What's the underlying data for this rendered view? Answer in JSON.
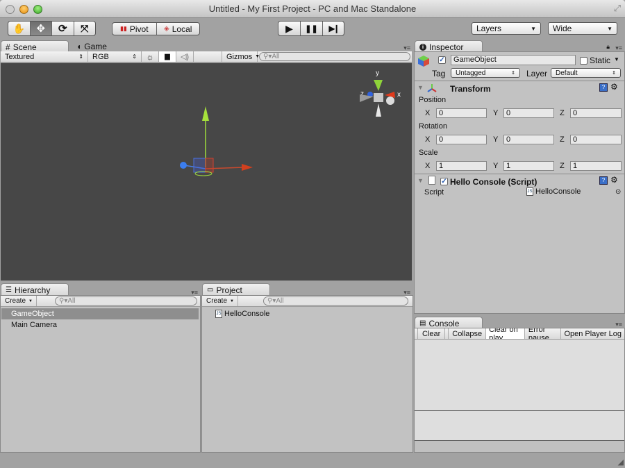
{
  "window": {
    "title": "Untitled - My First Project - PC and Mac Standalone",
    "traffic_lights": {
      "close": "#c8c8c8",
      "minimize": "#f0a020",
      "zoom": "#50c040"
    }
  },
  "toolbar": {
    "tools": [
      {
        "name": "hand-tool",
        "icon": "✋",
        "active": false
      },
      {
        "name": "move-tool",
        "icon": "✥",
        "active": true
      },
      {
        "name": "rotate-tool",
        "icon": "⟳",
        "active": false
      },
      {
        "name": "scale-tool",
        "icon": "⤧",
        "active": false
      }
    ],
    "pivot_label": "Pivot",
    "local_label": "Local",
    "play_icon": "▶",
    "pause_icon": "❚❚",
    "step_icon": "▶❙",
    "layers_label": "Layers",
    "layout_label": "Wide"
  },
  "scene": {
    "tabs": [
      {
        "label": "Scene",
        "icon": "#"
      },
      {
        "label": "Game",
        "icon": "◖"
      }
    ],
    "render_mode": "Textured",
    "color_mode": "RGB",
    "gizmos_label": "Gizmos",
    "search_placeholder": "All",
    "axis_labels": {
      "x": "x",
      "y": "y",
      "z": "z"
    }
  },
  "hierarchy": {
    "tab_label": "Hierarchy",
    "create_label": "Create",
    "search_placeholder": "All",
    "items": [
      {
        "label": "GameObject",
        "selected": true
      },
      {
        "label": "Main Camera",
        "selected": false
      }
    ]
  },
  "project": {
    "tab_label": "Project",
    "create_label": "Create",
    "search_placeholder": "All",
    "items": [
      {
        "label": "HelloConsole",
        "icon": "JS"
      }
    ]
  },
  "inspector": {
    "tab_label": "Inspector",
    "object_name": "GameObject",
    "active": true,
    "static_label": "Static",
    "static_checked": false,
    "tag_label": "Tag",
    "tag_value": "Untagged",
    "layer_label": "Layer",
    "layer_value": "Default",
    "transform": {
      "title": "Transform",
      "position_label": "Position",
      "rotation_label": "Rotation",
      "scale_label": "Scale",
      "position": {
        "x": "0",
        "y": "0",
        "z": "0"
      },
      "rotation": {
        "x": "0",
        "y": "0",
        "z": "0"
      },
      "scale": {
        "x": "1",
        "y": "1",
        "z": "1"
      },
      "axis": {
        "x": "X",
        "y": "Y",
        "z": "Z"
      }
    },
    "script_component": {
      "title": "Hello Console (Script)",
      "enabled": true,
      "field_label": "Script",
      "field_value": "HelloConsole"
    }
  },
  "console": {
    "tab_label": "Console",
    "buttons": [
      {
        "label": "Clear",
        "active": false
      },
      {
        "label": "Collapse",
        "active": false
      },
      {
        "label": "Clear on play",
        "active": true
      },
      {
        "label": "Error pause",
        "active": false
      },
      {
        "label": "Open Player Log",
        "active": false
      }
    ]
  }
}
